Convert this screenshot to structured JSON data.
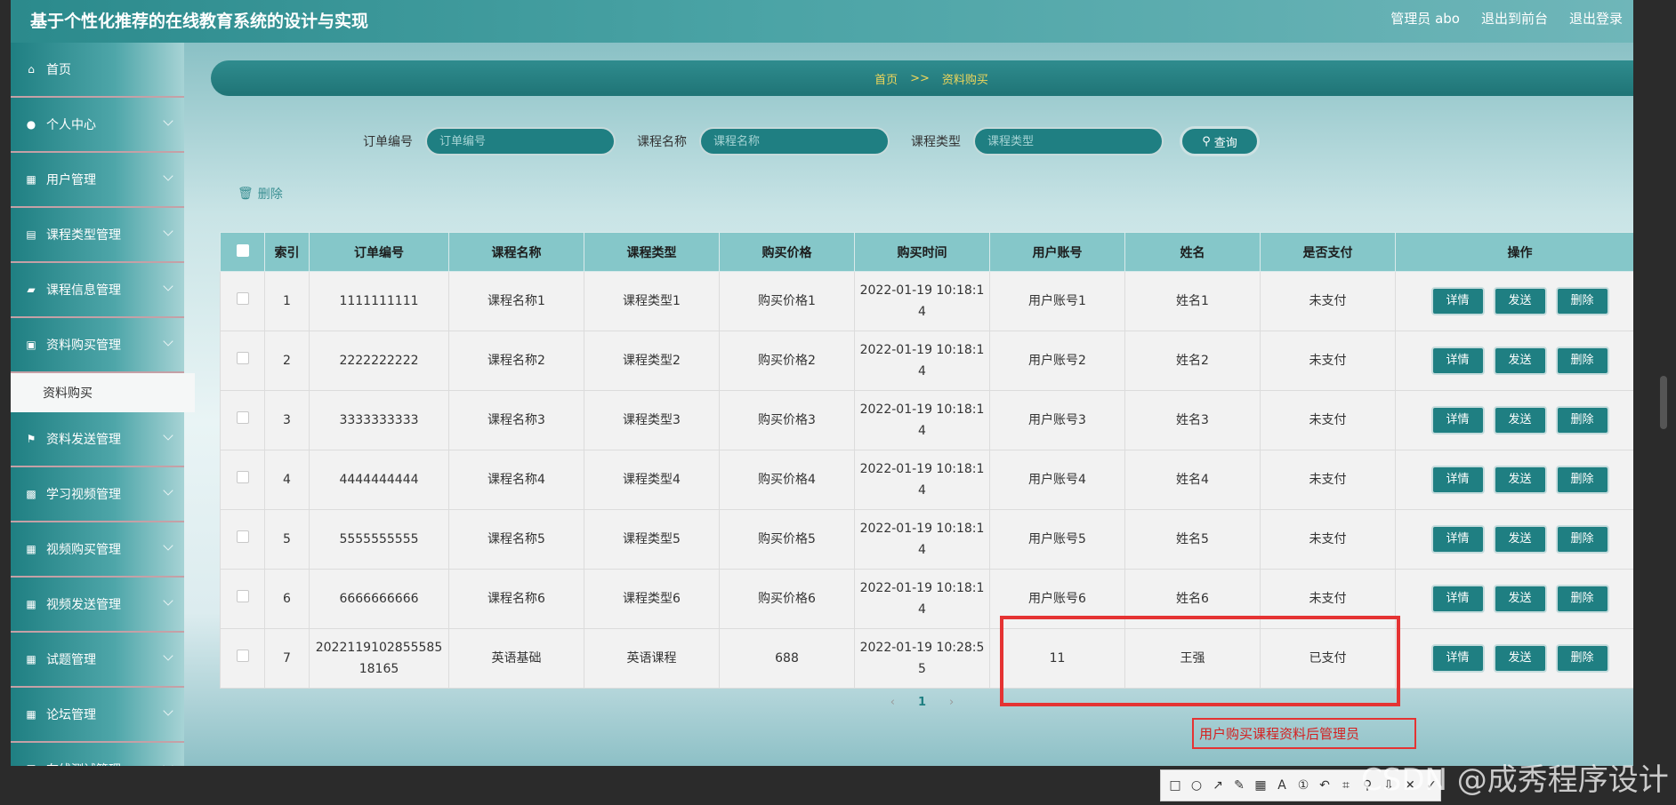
{
  "header": {
    "title": "基于个性化推荐的在线教育系统的设计与实现",
    "admin_label": "管理员 abo",
    "back_label": "退出到前台",
    "logout_label": "退出登录"
  },
  "sidebar": {
    "items": [
      {
        "label": "首页",
        "icon": "home-icon"
      },
      {
        "label": "个人中心",
        "icon": "user-icon"
      },
      {
        "label": "用户管理",
        "icon": "grid-icon"
      },
      {
        "label": "课程类型管理",
        "icon": "list-icon"
      },
      {
        "label": "课程信息管理",
        "icon": "message-icon"
      },
      {
        "label": "资料购买管理",
        "icon": "clipboard-icon"
      }
    ],
    "active_sub": "资料购买",
    "items_after": [
      {
        "label": "资料发送管理",
        "icon": "flag-icon"
      },
      {
        "label": "学习视频管理",
        "icon": "briefcase-icon"
      },
      {
        "label": "视频购买管理",
        "icon": "grid-icon"
      },
      {
        "label": "视频发送管理",
        "icon": "grid-icon"
      },
      {
        "label": "试题管理",
        "icon": "grid-icon"
      },
      {
        "label": "论坛管理",
        "icon": "grid-icon"
      },
      {
        "label": "在线测试管理",
        "icon": "sliders-icon"
      }
    ]
  },
  "breadcrumb": {
    "home": "首页",
    "sep": ">>",
    "current": "资料购买"
  },
  "search": {
    "order_label": "订单编号",
    "order_placeholder": "订单编号",
    "course_label": "课程名称",
    "course_placeholder": "课程名称",
    "type_label": "课程类型",
    "type_placeholder": "课程类型",
    "button": "查询"
  },
  "delete_label": "删除",
  "table": {
    "headers": [
      "索引",
      "订单编号",
      "课程名称",
      "课程类型",
      "购买价格",
      "购买时间",
      "用户账号",
      "姓名",
      "是否支付",
      "操作"
    ],
    "rows": [
      {
        "idx": "1",
        "order": "1111111111",
        "course": "课程名称1",
        "type": "课程类型1",
        "price": "购买价格1",
        "time": "2022-01-19 10:18:14",
        "account": "用户账号1",
        "name": "姓名1",
        "paid": "未支付"
      },
      {
        "idx": "2",
        "order": "2222222222",
        "course": "课程名称2",
        "type": "课程类型2",
        "price": "购买价格2",
        "time": "2022-01-19 10:18:14",
        "account": "用户账号2",
        "name": "姓名2",
        "paid": "未支付"
      },
      {
        "idx": "3",
        "order": "3333333333",
        "course": "课程名称3",
        "type": "课程类型3",
        "price": "购买价格3",
        "time": "2022-01-19 10:18:14",
        "account": "用户账号3",
        "name": "姓名3",
        "paid": "未支付"
      },
      {
        "idx": "4",
        "order": "4444444444",
        "course": "课程名称4",
        "type": "课程类型4",
        "price": "购买价格4",
        "time": "2022-01-19 10:18:14",
        "account": "用户账号4",
        "name": "姓名4",
        "paid": "未支付"
      },
      {
        "idx": "5",
        "order": "5555555555",
        "course": "课程名称5",
        "type": "课程类型5",
        "price": "购买价格5",
        "time": "2022-01-19 10:18:14",
        "account": "用户账号5",
        "name": "姓名5",
        "paid": "未支付"
      },
      {
        "idx": "6",
        "order": "6666666666",
        "course": "课程名称6",
        "type": "课程类型6",
        "price": "购买价格6",
        "time": "2022-01-19 10:18:14",
        "account": "用户账号6",
        "name": "姓名6",
        "paid": "未支付"
      },
      {
        "idx": "7",
        "order": "202211910285558518165",
        "course": "英语基础",
        "type": "英语课程",
        "price": "688",
        "time": "2022-01-19 10:28:55",
        "account": "11",
        "name": "王强",
        "paid": "已支付"
      }
    ],
    "ops": {
      "detail": "详情",
      "send": "发送",
      "delete": "删除"
    }
  },
  "pager": {
    "prev": "‹",
    "page": "1",
    "next": "›"
  },
  "annotation": "用户购买课程资料后管理员",
  "watermark": "CSDN @成秀程序设计",
  "colors": {
    "primary": "#1f7f82",
    "header_row": "#85c7c9",
    "breadcrumb_text": "#f0d75a",
    "highlight": "#e53333"
  }
}
